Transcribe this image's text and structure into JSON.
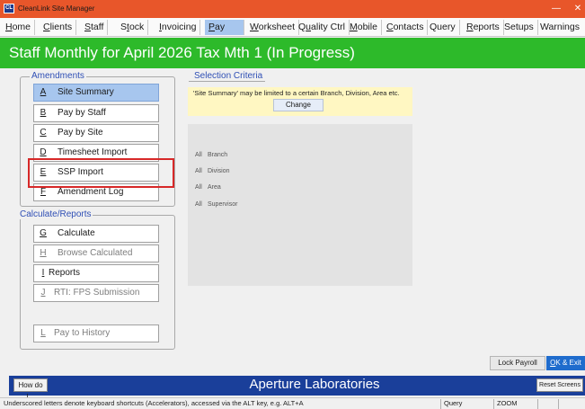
{
  "window": {
    "icon_text": "CL",
    "title": "CleanLink Site Manager",
    "minimize_glyph": "—",
    "close_glyph": "✕"
  },
  "menu": [
    {
      "key": "H",
      "rest": "ome",
      "pre": ""
    },
    {
      "key": "C",
      "rest": "lients",
      "pre": ""
    },
    {
      "key": "S",
      "rest": "taff",
      "pre": ""
    },
    {
      "key": "t",
      "rest": "ock",
      "pre": "S"
    },
    {
      "key": "I",
      "rest": "nvoicing",
      "pre": ""
    },
    {
      "key": "P",
      "rest": "ay",
      "pre": ""
    },
    {
      "key": "W",
      "rest": "orksheet",
      "pre": ""
    },
    {
      "key": "u",
      "rest": "ality Ctrl",
      "pre": "Q"
    },
    {
      "key": "M",
      "rest": "obile",
      "pre": ""
    },
    {
      "key": "C",
      "rest": "ontacts",
      "pre": ""
    },
    {
      "key": "",
      "rest": "Query",
      "pre": ""
    },
    {
      "key": "R",
      "rest": "eports",
      "pre": ""
    },
    {
      "key": "",
      "rest": "Setups",
      "pre": ""
    },
    {
      "key": "",
      "rest": "Warnings",
      "pre": ""
    }
  ],
  "page_title": "Staff Monthly for April 2026 Tax Mth  1  (In Progress)",
  "amendments": {
    "label": "Amendments",
    "items": [
      {
        "key": "A",
        "label": "Site Summary"
      },
      {
        "key": "B",
        "label": "Pay by Staff"
      },
      {
        "key": "C",
        "label": "Pay by Site"
      },
      {
        "key": "D",
        "label": "Timesheet Import"
      },
      {
        "key": "E",
        "label": "SSP Import"
      },
      {
        "key": "F",
        "label": "Amendment Log"
      }
    ]
  },
  "calculate": {
    "label": "Calculate/Reports",
    "items": [
      {
        "key": "G",
        "label": "Calculate"
      },
      {
        "key": "H",
        "label": "Browse Calculated"
      },
      {
        "key": "I",
        "label": "Reports"
      },
      {
        "key": "J",
        "label": "RTI: FPS Submission"
      }
    ],
    "history": {
      "key": "L",
      "label": "Pay to History"
    }
  },
  "selection": {
    "label": "Selection Criteria",
    "text": "'Site Summary' may be limited to a certain Branch, Division, Area etc.",
    "change_label": "Change",
    "filters": [
      {
        "value": "All",
        "name": "Branch"
      },
      {
        "value": "All",
        "name": "Division"
      },
      {
        "value": "All",
        "name": "Area"
      },
      {
        "value": "All",
        "name": "Supervisor"
      }
    ]
  },
  "actions": {
    "lock_payroll": "Lock Payroll",
    "ok_key": "O",
    "ok_rest": "K & Exit"
  },
  "footer": {
    "how_do_i": "How do I...",
    "company": "Aperture Laboratories",
    "reset_screens": "Reset Screens"
  },
  "status": {
    "hint": "Underscored letters denote keyboard shortcuts (Accelerators), accessed via the ALT key, e.g. ALT+A",
    "mode": "Query",
    "zoom": "ZOOM"
  }
}
